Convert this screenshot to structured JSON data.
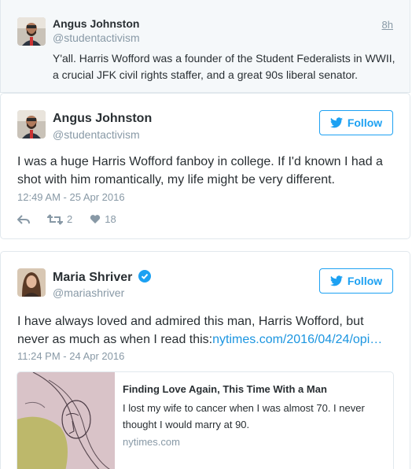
{
  "parent_tweet": {
    "author_name": "Angus Johnston",
    "handle": "@studentactivism",
    "time_ago": "8h",
    "text": "Y'all. Harris Wofford was a founder of the Student Federalists in WWII, a crucial JFK civil rights staffer, and a great 90s liberal senator."
  },
  "tweet_1": {
    "author_name": "Angus Johnston",
    "handle": "@studentactivism",
    "follow_label": "Follow",
    "text": "I was a huge Harris Wofford fanboy in college. If I'd known I had a shot with him romantically, my life might be very different.",
    "timestamp": "12:49 AM - 25 Apr 2016",
    "retweets": "2",
    "likes": "18"
  },
  "tweet_2": {
    "author_name": "Maria Shriver",
    "handle": "@mariashriver",
    "follow_label": "Follow",
    "text": "I have always loved and admired this man, Harris Wofford, but never as much as when I read this:",
    "link_text": "nytimes.com/2016/04/24/opi…",
    "timestamp": "11:24 PM - 24 Apr 2016",
    "verified_icon": "verified-badge-icon"
  },
  "link_preview": {
    "title": "Finding Love Again, This Time With a Man",
    "description": "I lost my wife to cancer when I was almost 70. I never thought I would marry at 90.",
    "domain": "nytimes.com"
  },
  "colors": {
    "accent": "#1da1f2",
    "link": "#1b95e0",
    "muted": "#8899a6",
    "verified": "#1da1f2",
    "parent_bg": "#f5f8fa"
  }
}
